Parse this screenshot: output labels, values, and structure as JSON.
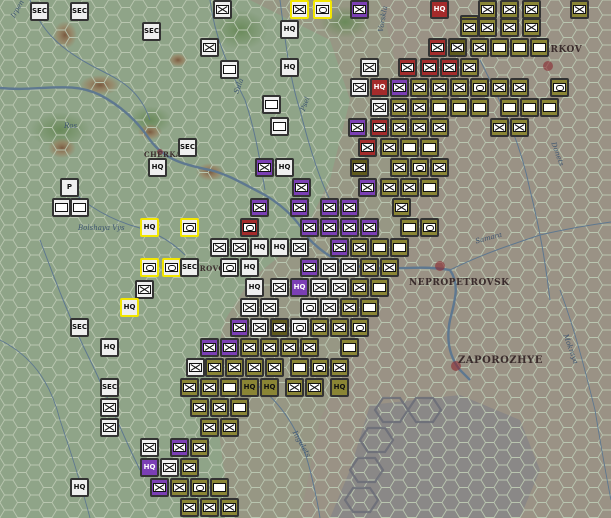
{
  "map": {
    "colors": {
      "land": "#8fa488",
      "hex_line": "#b9c6b0",
      "river": "#5e7890",
      "german_counter": "#efefef",
      "soviet_counter": "#8a8535",
      "soviet_counter_dark": "#5f5a1c",
      "selected_outline": "#f2e600",
      "hq_counter": "#d8d8d8",
      "purple_unit": "#7b3fb5",
      "red_unit": "#a42b2b"
    },
    "cities": [
      {
        "id": "kharkov",
        "label": "ARKOV"
      },
      {
        "id": "cherkasy",
        "label": "CHERKAS"
      },
      {
        "id": "kirovograd",
        "label": "IROVO"
      },
      {
        "id": "dnepropetrovsk",
        "label": "NEPROPETROVSK"
      },
      {
        "id": "zaporozhye",
        "label": "ZAPOROZHYE"
      }
    ],
    "rivers": [
      {
        "id": "ros",
        "label": "Ros"
      },
      {
        "id": "bolshaya-vys",
        "label": "Bolshaya Vys"
      },
      {
        "id": "samara",
        "label": "Samara"
      },
      {
        "id": "sula",
        "label": "Sula"
      },
      {
        "id": "psel",
        "label": "Psel"
      },
      {
        "id": "vorskla",
        "label": "Vorskla"
      },
      {
        "id": "donets",
        "label": "Donets"
      },
      {
        "id": "ingulets",
        "label": "Ingulets"
      },
      {
        "id": "irpen",
        "label": "Irpen"
      },
      {
        "id": "mokraya",
        "label": "Mokraya"
      }
    ],
    "unit_types": {
      "hq": "HQ",
      "sec": "SEC",
      "partisan": "P"
    }
  }
}
